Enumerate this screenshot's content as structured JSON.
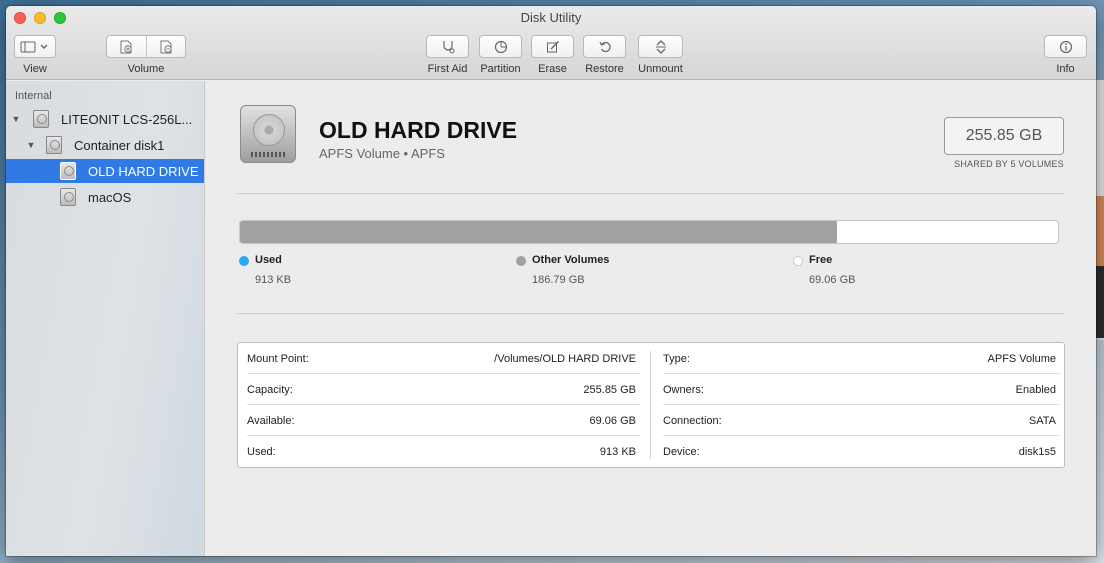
{
  "window": {
    "title": "Disk Utility"
  },
  "toolbar": {
    "view_label": "View",
    "volume_label": "Volume",
    "first_aid_label": "First Aid",
    "partition_label": "Partition",
    "erase_label": "Erase",
    "restore_label": "Restore",
    "unmount_label": "Unmount",
    "info_label": "Info"
  },
  "sidebar": {
    "section": "Internal",
    "items": [
      {
        "label": "LITEONIT LCS-256L...",
        "icon": "internal-disk-icon",
        "expanded": true
      },
      {
        "label": "Container disk1",
        "icon": "container-icon",
        "expanded": true
      },
      {
        "label": "OLD HARD DRIVE",
        "icon": "volume-icon",
        "selected": true
      },
      {
        "label": "macOS",
        "icon": "volume-icon"
      }
    ]
  },
  "volume": {
    "name": "OLD HARD DRIVE",
    "subtitle": "APFS Volume • APFS",
    "capacity": "255.85 GB",
    "shared_note": "SHARED BY 5 VOLUMES"
  },
  "usage": {
    "used_fraction": 0.0001,
    "other_fraction": 0.73,
    "legend": [
      {
        "name": "Used",
        "value": "913 KB",
        "color": "#2aa9f0"
      },
      {
        "name": "Other Volumes",
        "value": "186.79 GB",
        "color": "#a1a1a1"
      },
      {
        "name": "Free",
        "value": "69.06 GB",
        "color": "#ffffff"
      }
    ]
  },
  "info": {
    "left": [
      {
        "label": "Mount Point:",
        "value": "/Volumes/OLD HARD DRIVE"
      },
      {
        "label": "Capacity:",
        "value": "255.85 GB"
      },
      {
        "label": "Available:",
        "value": "69.06 GB"
      },
      {
        "label": "Used:",
        "value": "913 KB"
      }
    ],
    "right": [
      {
        "label": "Type:",
        "value": "APFS Volume"
      },
      {
        "label": "Owners:",
        "value": "Enabled"
      },
      {
        "label": "Connection:",
        "value": "SATA"
      },
      {
        "label": "Device:",
        "value": "disk1s5"
      }
    ]
  },
  "colors": {
    "accent": "#2f7ae5",
    "used": "#2aa9f0",
    "other": "#a1a1a1"
  }
}
